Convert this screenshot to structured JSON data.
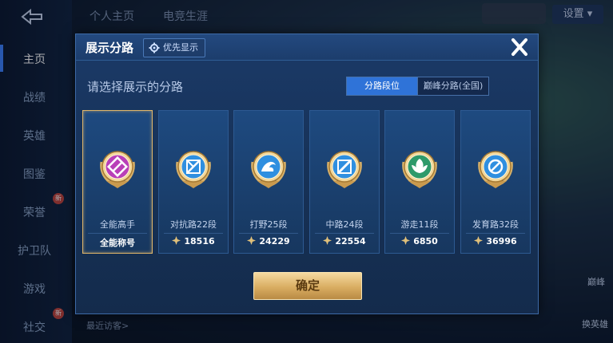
{
  "background": {
    "top_tabs": [
      "个人主页",
      "电竞生涯"
    ],
    "settings_label": "设置",
    "sidebar_items": [
      {
        "label": "主页",
        "active": true
      },
      {
        "label": "战绩"
      },
      {
        "label": "英雄"
      },
      {
        "label": "图鉴"
      },
      {
        "label": "荣誉",
        "badge": "新"
      },
      {
        "label": "护卫队"
      },
      {
        "label": "游戏"
      },
      {
        "label": "社交",
        "badge": "新"
      }
    ],
    "recent_visitors_label": "最近访客>",
    "right_label_1": "巅峰",
    "right_label_2": "换英雄"
  },
  "modal": {
    "title": "展示分路",
    "priority_button": "优先显示",
    "subtitle": "请选择展示的分路",
    "segments": [
      {
        "label": "分路段位",
        "active": true
      },
      {
        "label": "巅峰分路(全国)",
        "active": false
      }
    ],
    "cards": [
      {
        "role": "全能高手",
        "value": "全能称号",
        "selected": true,
        "emblem_color": "#b93fb8",
        "emblem": "omni-icon"
      },
      {
        "role": "对抗路22段",
        "value": "18516",
        "emblem_color": "#2f8fe0",
        "emblem": "clash-lane-icon"
      },
      {
        "role": "打野25段",
        "value": "24229",
        "emblem_color": "#2f8fe0",
        "emblem": "jungle-icon"
      },
      {
        "role": "中路24段",
        "value": "22554",
        "emblem_color": "#2f8fe0",
        "emblem": "mid-lane-icon"
      },
      {
        "role": "游走11段",
        "value": "6850",
        "emblem_color": "#2e9a6a",
        "emblem": "roam-icon"
      },
      {
        "role": "发育路32段",
        "value": "36996",
        "emblem_color": "#2f8fe0",
        "emblem": "farm-lane-icon"
      }
    ],
    "confirm_label": "确定"
  },
  "colors": {
    "gold": "#e0b66a",
    "accent_blue": "#2f73d8"
  }
}
